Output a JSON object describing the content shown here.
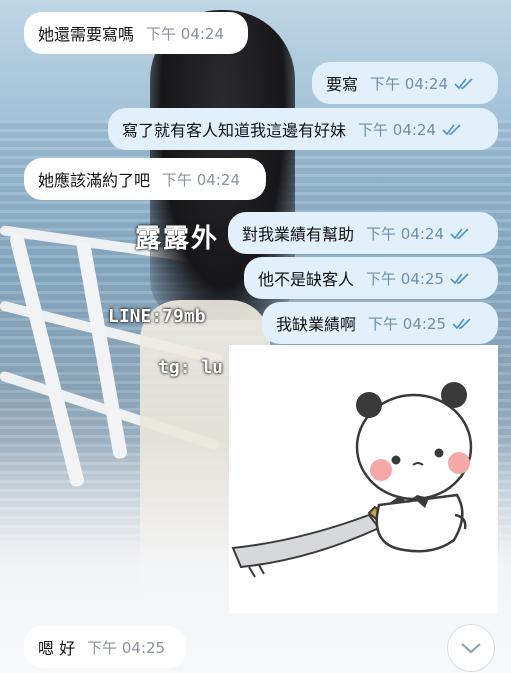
{
  "overlay": {
    "banner": "露露外",
    "line_id": "LINE:79mb",
    "tg": "tg: lu"
  },
  "messages": [
    {
      "direction": "in",
      "text": "她還需要寫嗎",
      "time": "下午 04:24"
    },
    {
      "direction": "out",
      "text": "要寫",
      "time": "下午 04:24",
      "status": "read"
    },
    {
      "direction": "out",
      "text": "寫了就有客人知道我這邊有好妹",
      "time": "下午 04:24",
      "status": "read"
    },
    {
      "direction": "in",
      "text": "她應該滿約了吧",
      "time": "下午 04:24"
    },
    {
      "direction": "out",
      "text": "對我業績有幫助",
      "time": "下午 04:24",
      "status": "read"
    },
    {
      "direction": "out",
      "text": "他不是缺客人",
      "time": "下午 04:25",
      "status": "read"
    },
    {
      "direction": "out",
      "text": "我缺業績啊",
      "time": "下午 04:25",
      "status": "read"
    },
    {
      "direction": "in",
      "text": "嗯 好",
      "time": "下午 04:25"
    }
  ],
  "sticker": {
    "description_icon": "panda-with-sword-sticker"
  },
  "colors": {
    "incoming": "#ffffff",
    "outgoing": "#e1f0fb",
    "tick": "#4a90c9"
  }
}
